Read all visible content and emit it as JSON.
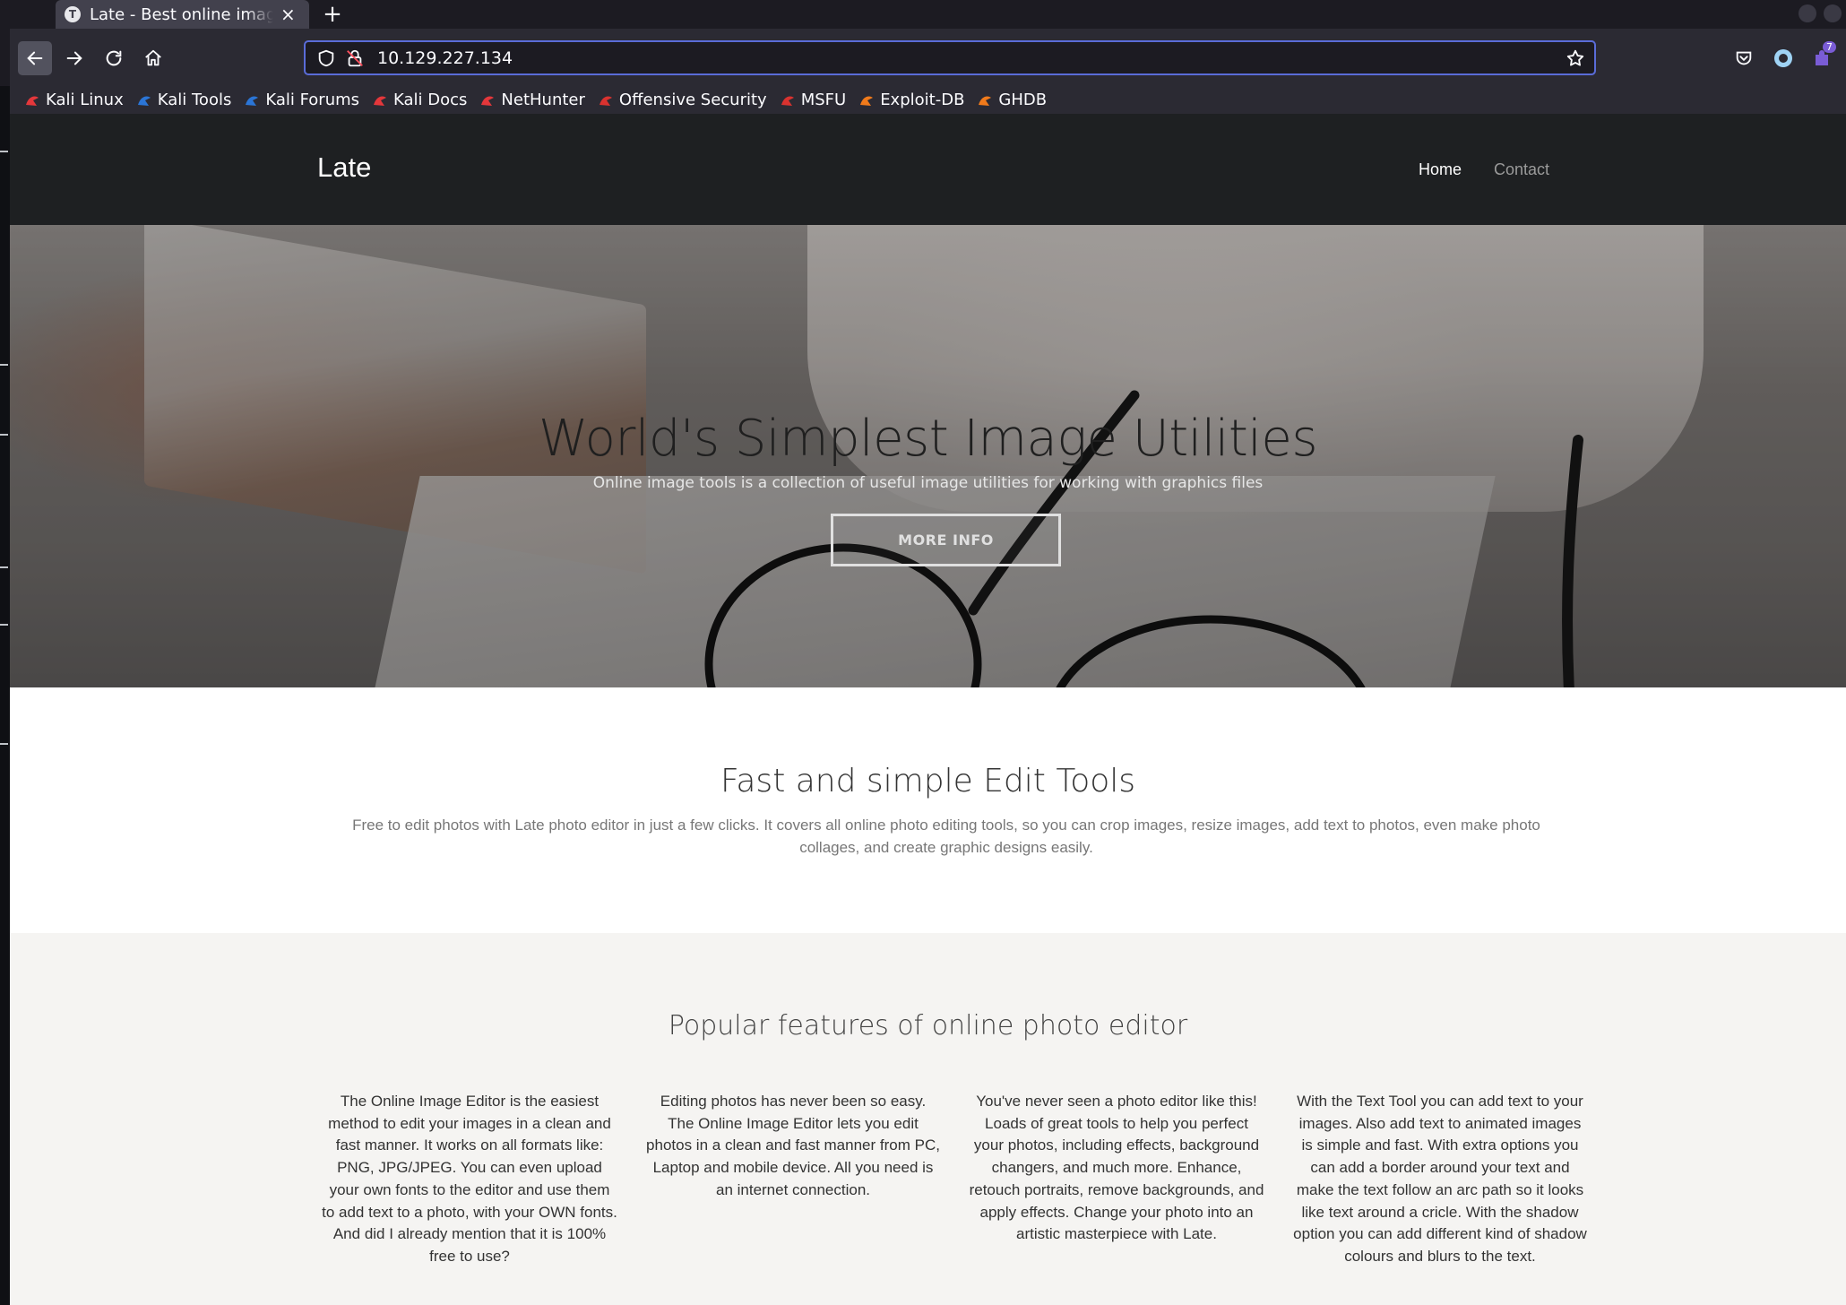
{
  "browser": {
    "tab_title": "Late - Best online image tools",
    "tab_favicon_letter": "T",
    "tab_close_glyph": "×",
    "new_tab_glyph": "+",
    "url": "10.129.227.134",
    "url_focus_color": "#5a6cd8",
    "extension_badge": "7",
    "bookmarks": [
      {
        "label": "Kali Linux",
        "icon": "kali-dragon-icon"
      },
      {
        "label": "Kali Tools",
        "icon": "kali-tools-icon"
      },
      {
        "label": "Kali Forums",
        "icon": "kali-forums-icon"
      },
      {
        "label": "Kali Docs",
        "icon": "kali-docs-icon"
      },
      {
        "label": "NetHunter",
        "icon": "nethunter-icon"
      },
      {
        "label": "Offensive Security",
        "icon": "offsec-icon"
      },
      {
        "label": "MSFU",
        "icon": "msfu-icon"
      },
      {
        "label": "Exploit-DB",
        "icon": "exploit-db-icon"
      },
      {
        "label": "GHDB",
        "icon": "ghdb-icon"
      }
    ]
  },
  "site": {
    "logo": "Late",
    "nav": [
      {
        "label": "Home",
        "active": true
      },
      {
        "label": "Contact",
        "active": false
      }
    ],
    "nav_active_color": "#ffffff",
    "nav_inactive_color": "#9a9a9a"
  },
  "hero": {
    "title": "World's Simplest Image Utilities",
    "subtitle": "Online image tools is a collection of useful image utilities for working with graphics files",
    "button_label": "MORE INFO"
  },
  "edit_tools": {
    "title": "Fast and simple Edit Tools",
    "description": "Free to edit photos with Late photo editor in just a few clicks. It covers all online photo editing tools, so you can crop images, resize images, add text to photos, even make photo collages, and create graphic designs easily."
  },
  "features": {
    "title": "Popular features of online photo editor",
    "items": [
      "The Online Image Editor is the easiest method to edit your images in a clean and fast manner. It works on all formats like: PNG, JPG/JPEG. You can even upload your own fonts to the editor and use them to add text to a photo, with your OWN fonts. And did I already mention that it is 100% free to use?",
      "Editing photos has never been so easy. The Online Image Editor lets you edit photos in a clean and fast manner from PC, Laptop and mobile device. All you need is an internet connection.",
      "You've never seen a photo editor like this! Loads of great tools to help you perfect your photos, including effects, background changers, and much more. Enhance, retouch portraits, remove backgrounds, and apply effects. Change your photo into an artistic masterpiece with Late.",
      "With the Text Tool you can add text to your images. Also add text to animated images is simple and fast. With extra options you can add a border around your text and make the text follow an arc path so it looks like text around a cricle. With the shadow option you can add different kind of shadow colours and blurs to the text."
    ]
  }
}
